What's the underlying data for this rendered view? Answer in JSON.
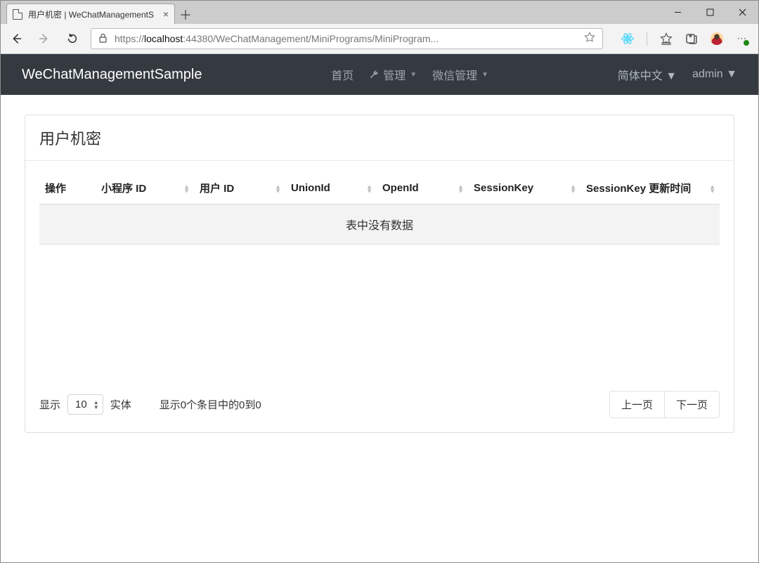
{
  "browser": {
    "tab_title": "用户机密 | WeChatManagementS",
    "url_prefix": "https://",
    "url_host": "localhost",
    "url_path": ":44380/WeChatManagement/MiniPrograms/MiniProgram..."
  },
  "navbar": {
    "brand": "WeChatManagementSample",
    "home": "首页",
    "administration": "管理",
    "wechat_mgmt": "微信管理",
    "language": "简体中文",
    "user": "admin"
  },
  "page": {
    "title": "用户机密"
  },
  "table": {
    "columns": {
      "actions": "操作",
      "miniprogram_id": "小程序 ID",
      "user_id": "用户 ID",
      "union_id": "UnionId",
      "open_id": "OpenId",
      "session_key": "SessionKey",
      "session_key_updated": "SessionKey 更新时间"
    },
    "empty_message": "表中没有数据",
    "rows": []
  },
  "footer": {
    "length_prefix": "显示",
    "length_value": "10",
    "length_suffix": "实体",
    "info_text": "显示0个条目中的0到0",
    "prev": "上一页",
    "next": "下一页"
  }
}
